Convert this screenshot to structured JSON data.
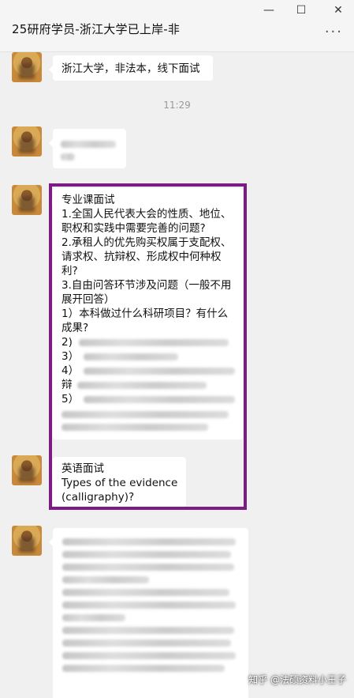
{
  "window": {
    "title": "25研府学员-浙江大学已上岸-非",
    "controls": {
      "minimize": "—",
      "maximize": "☐",
      "close": "✕",
      "more": "···"
    }
  },
  "messages": {
    "first": "浙江大学，非法本，线下面试",
    "timestamp": "11:29",
    "professional": {
      "lines": [
        "专业课面试",
        "1.全国人民代表大会的性质、地位、",
        "职权和实践中需要完善的问题?",
        "2.承租人的优先购买权属于支配权、",
        "请求权、抗辩权、形成权中何种权",
        "利?",
        "3.自由问答环节涉及问题（一般不用",
        "展开回答）",
        "1）本科做过什么科研项目？有什么",
        "成果?",
        "2)",
        "3）",
        "4）",
        "辩",
        "5）"
      ]
    },
    "english": {
      "lines": [
        "英语面试",
        "Types of the evidence",
        "(calligraphy)?"
      ]
    }
  },
  "watermark": "知乎 @法硕资料小王子",
  "colors": {
    "highlight": "#7b1b83",
    "background": "#f0f0f0",
    "bubble": "#ffffff"
  },
  "icons": [
    "avatar-image",
    "minimize-icon",
    "maximize-icon",
    "close-icon",
    "more-icon"
  ]
}
